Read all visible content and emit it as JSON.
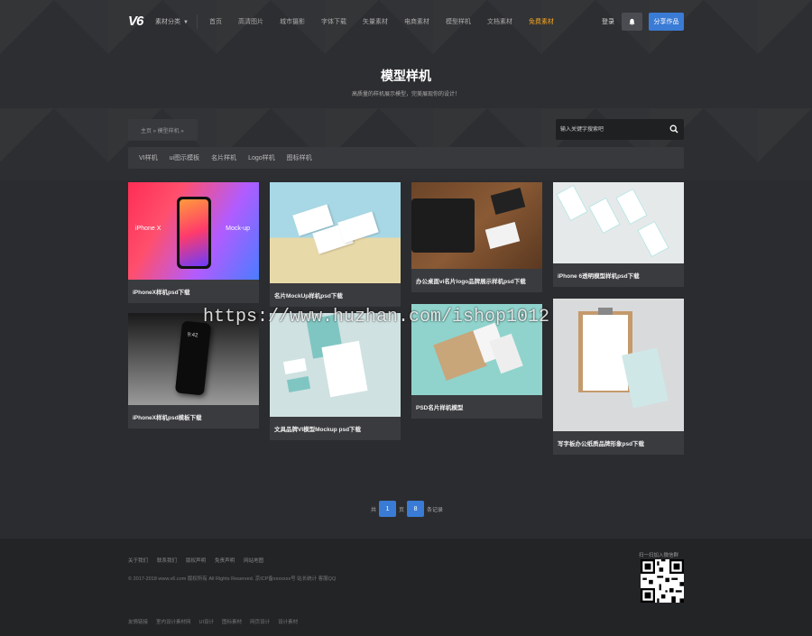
{
  "header": {
    "logo": "V6",
    "category_label": "素材分类",
    "nav": [
      "首页",
      "高清图片",
      "城市摄影",
      "字体下载",
      "矢量素材",
      "电商素材",
      "模型样机",
      "文档素材",
      "免费素材"
    ],
    "login": "登录",
    "publish": "分享作品"
  },
  "hero": {
    "title": "模型样机",
    "subtitle": "高质量的样机展示模型，完美展现你的设计！"
  },
  "breadcrumb": "主页 » 模型样机 »",
  "search": {
    "placeholder": "输入关键字搜索吧"
  },
  "tabs": [
    "VI样机",
    "ui图示模板",
    "名片样机",
    "Logo样机",
    "图标样机"
  ],
  "cards": [
    {
      "caption": "iPhoneX样机psd下载"
    },
    {
      "caption": "名片MockUp样机psd下载"
    },
    {
      "caption": "办公桌面vi名片logo品牌展示样机psd下载"
    },
    {
      "caption": "iPhone 6透明模型样机psd下载"
    },
    {
      "caption": "iPhoneX样机psd模板下载"
    },
    {
      "caption": "文具品牌VI模型Mockup psd下载"
    },
    {
      "caption": "PSD名片样机模型"
    },
    {
      "caption": "写字板办公纸质品牌形象psd下载"
    }
  ],
  "card_text": {
    "iphone_left": "iPhone X",
    "iphone_right": "Mock-up",
    "phone_time": "9:42"
  },
  "watermark": "https://www.huzhan.com/ishop1012",
  "pager": {
    "prefix": "共",
    "current": "1",
    "mid": "页",
    "total": "8",
    "suffix": "条记录"
  },
  "footer": {
    "links": [
      "关于我们",
      "联系我们",
      "版权声明",
      "免责声明",
      "网站地图"
    ],
    "copyright": "© 2017-2018 www.v6.com 版权所有 All Rights Reserved. 京ICP备xxxxxxx号 站长统计   客服QQ",
    "qr_label": "扫一扫加入微信群",
    "friends": [
      "友情链接",
      "室内设计素材网",
      "UI设计",
      "图标素材",
      "网页设计",
      "设计素材"
    ]
  },
  "colors": {
    "accent": "#3a7bd5",
    "highlight": "#f5a623",
    "background": "#2b2c2f",
    "footer": "#232426"
  }
}
